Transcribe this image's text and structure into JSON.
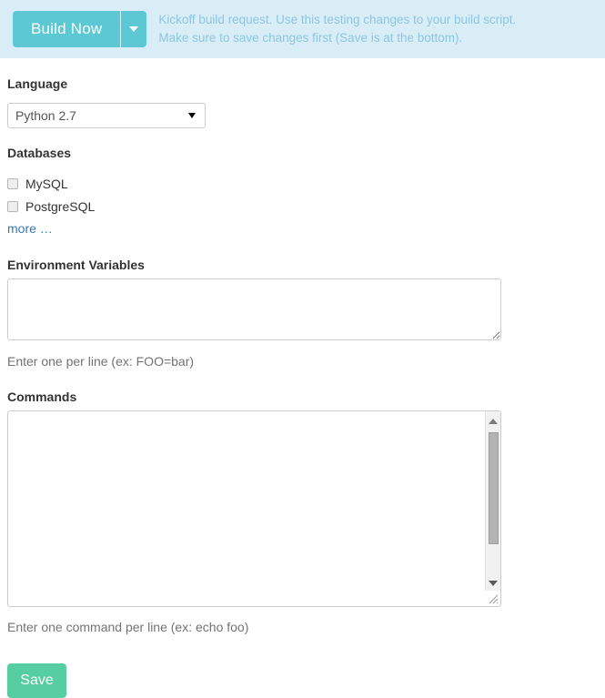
{
  "alert": {
    "build_button_label": "Build Now",
    "dropdown_icon": "caret-down-icon",
    "message_line1": "Kickoff build request. Use this testing changes to your build script.",
    "message_line2": "Make sure to save changes first (Save is at the bottom).",
    "background_color": "#d9edf7",
    "text_color": "#8cc6e2",
    "button_color": "#5bc8d4"
  },
  "language": {
    "label": "Language",
    "selected": "Python 2.7",
    "caret_icon": "caret-down-icon"
  },
  "databases": {
    "label": "Databases",
    "options": [
      {
        "label": "MySQL",
        "checked": false
      },
      {
        "label": "PostgreSQL",
        "checked": false
      }
    ],
    "more_link": "more …"
  },
  "environment_variables": {
    "label": "Environment Variables",
    "value": "",
    "placeholder": "",
    "help": "Enter one per line (ex: FOO=bar)",
    "resize_icon": "resize-grip-icon"
  },
  "commands": {
    "label": "Commands",
    "value": "",
    "placeholder": "",
    "help": "Enter one command per line (ex: echo foo)",
    "scrollbar": {
      "up_icon": "scroll-up-arrow-icon",
      "down_icon": "scroll-down-arrow-icon",
      "thumb_color": "#b3b3b3"
    },
    "resize_icon": "resize-grip-icon"
  },
  "save": {
    "label": "Save",
    "color": "#57cea1"
  }
}
